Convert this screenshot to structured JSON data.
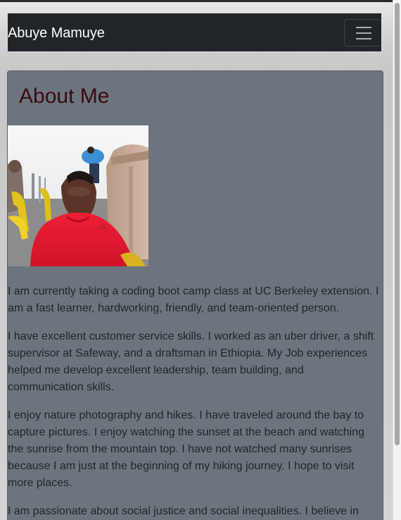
{
  "navbar": {
    "brand": "Abuye Mamuye",
    "toggler_icon": "hamburger-menu-icon"
  },
  "about": {
    "title": "About Me",
    "paragraphs": [
      "I am currently taking a coding boot camp class at UC Berkeley extension. I am a fast learner, hardworking, friendly, and team-oriented person.",
      "I have excellent customer service skills. I worked as an uber driver, a shift supervisor at Safeway, and a draftsman in Ethiopia. My Job experiences helped me develop excellent leadership, team building, and communication skills.",
      "I enjoy nature photography and hikes. I have traveled around the bay to capture pictures. I enjoy watching the sunset at the beach and watching the sunrise from the mountain top. I have not watched many sunrises because I am just at the beginning of my hiking journey. I hope to visit more places.",
      "I am passionate about social justice and social inequalities. I believe in"
    ],
    "shirt_logo_text": "ck"
  },
  "colors": {
    "navbar_bg": "#212529",
    "card_bg": "#6c757d",
    "title_color": "#3b0a10",
    "body_text": "#212529"
  }
}
